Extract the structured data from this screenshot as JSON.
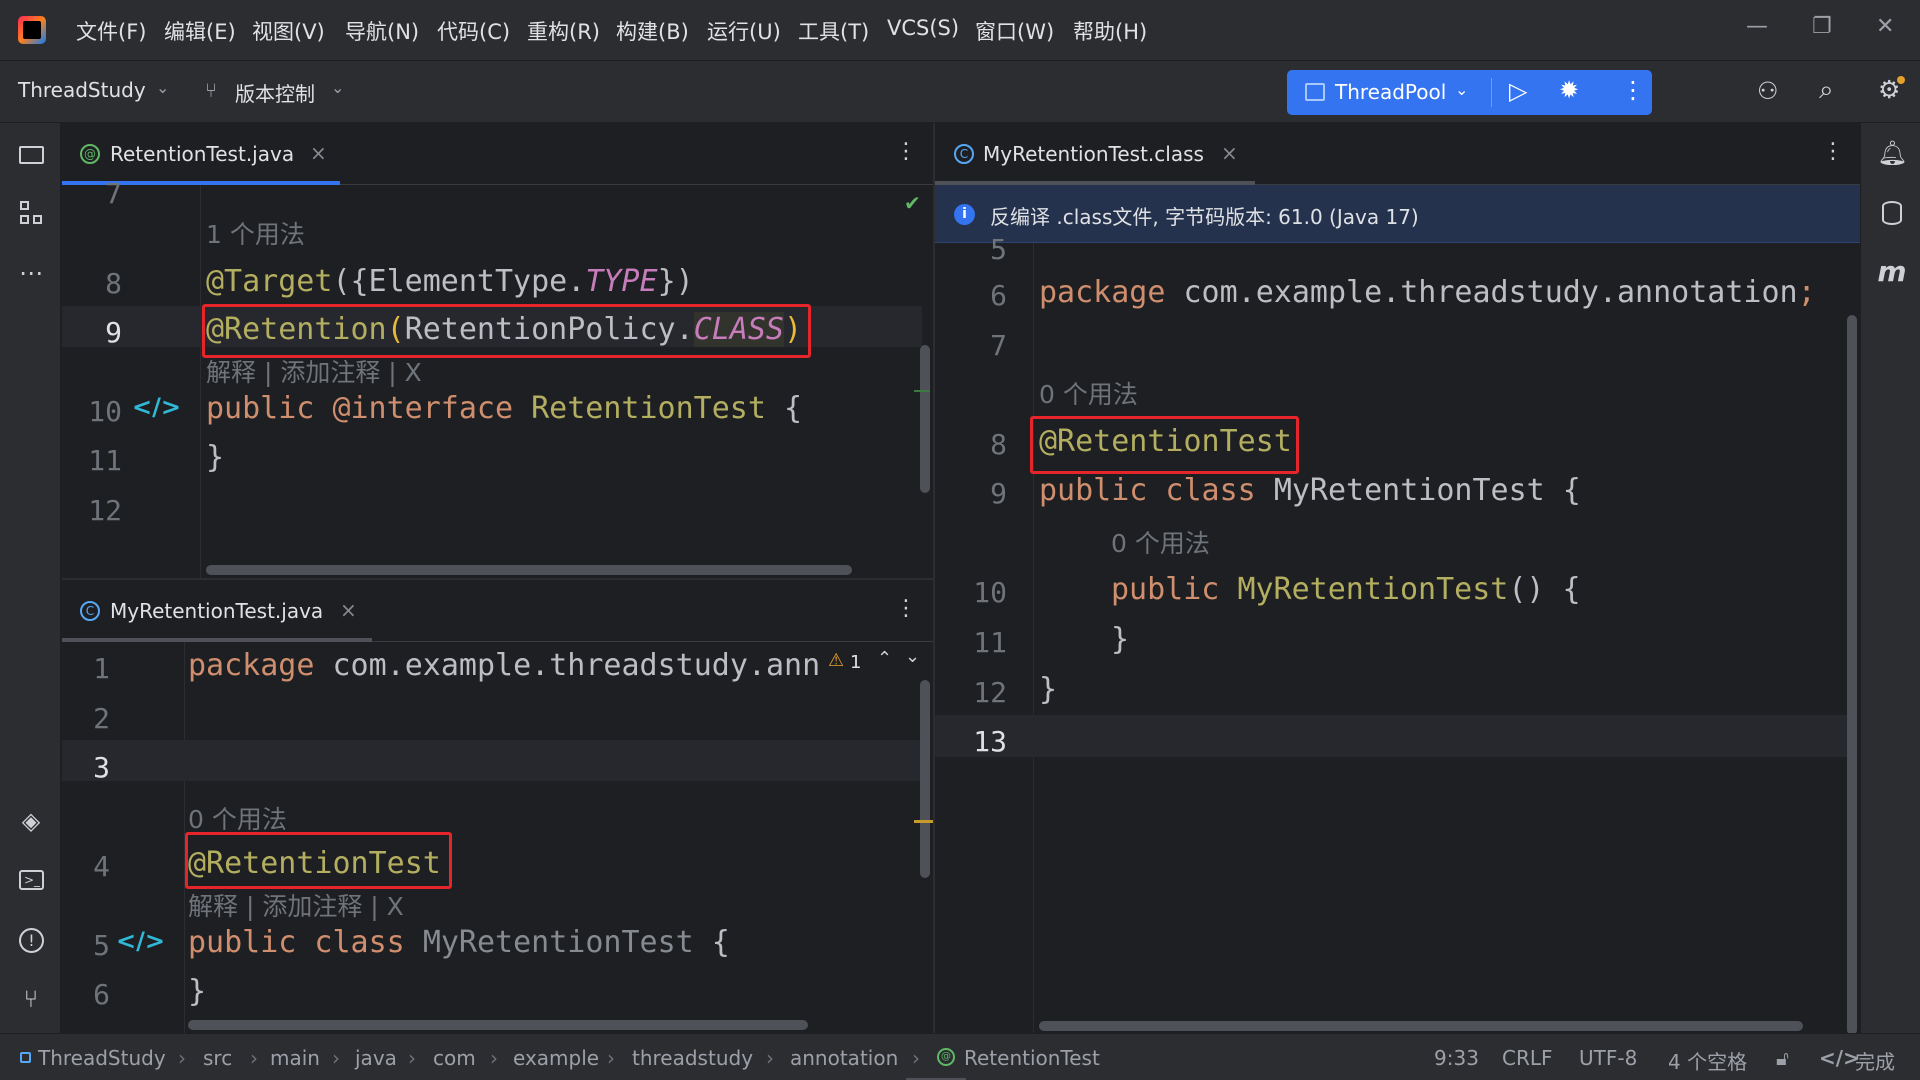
{
  "menu": [
    "文件(F)",
    "编辑(E)",
    "视图(V)",
    "导航(N)",
    "代码(C)",
    "重构(R)",
    "构建(B)",
    "运行(U)",
    "工具(T)",
    "VCS(S)",
    "窗口(W)",
    "帮助(H)"
  ],
  "toolbar": {
    "project": "ThreadStudy",
    "vcs": "版本控制",
    "run_config": "ThreadPool"
  },
  "editor_top_left": {
    "tab_label": "RetentionTest.java",
    "lines": [
      "8",
      "9",
      "10",
      "11",
      "12"
    ],
    "partial_line": "7",
    "usage_hint": "1 个用法",
    "inlay_hint": "解释 | 添加注释 | X",
    "code": {
      "l8_a": "@Target",
      "l8_b": "({ElementType.",
      "l8_c": "TYPE",
      "l8_d": "})",
      "l9_a": "@Retention",
      "l9_b": "(",
      "l9_c": "RetentionPolicy.",
      "l9_d": "CLASS",
      "l9_e": ")",
      "l10_a": "public ",
      "l10_b": "@interface ",
      "l10_c": "RetentionTest",
      "l10_d": " {",
      "l11": "}"
    }
  },
  "editor_bottom_left": {
    "tab_label": "MyRetentionTest.java",
    "lines": [
      "1",
      "2",
      "3",
      "4",
      "5",
      "6"
    ],
    "warning_count": "1",
    "usage_hint": "0 个用法",
    "inlay_hint": "解释 | 添加注释 | X",
    "code": {
      "l1_a": "package ",
      "l1_b": "com.example.threadstudy.ann",
      "l4": "@RetentionTest",
      "l5_a": "public class ",
      "l5_b": "MyRetentionTest",
      "l5_c": " {",
      "l6": "}"
    }
  },
  "editor_right": {
    "tab_label": "MyRetentionTest.class",
    "banner": "反编译 .class文件, 字节码版本: 61.0 (Java 17)",
    "partial_line": "5",
    "lines": [
      "6",
      "7",
      "8",
      "9",
      "10",
      "11",
      "12",
      "13"
    ],
    "usage_hint_class": "0 个用法",
    "usage_hint_ctor": "0 个用法",
    "code": {
      "l6_a": "package ",
      "l6_b": "com.example.threadstudy.annotation",
      "l6_c": ";",
      "l8": "@RetentionTest",
      "l9_a": "public class ",
      "l9_b": "MyRetentionTest",
      "l9_c": " {",
      "l10_a": "public ",
      "l10_b": "MyRetentionTest",
      "l10_c": "() {",
      "l11": "}",
      "l12": "}"
    }
  },
  "statusbar": {
    "breadcrumb": [
      "ThreadStudy",
      "src",
      "main",
      "java",
      "com",
      "example",
      "threadstudy",
      "annotation",
      "RetentionTest"
    ],
    "position": "9:33",
    "line_sep": "CRLF",
    "encoding": "UTF-8",
    "indent": "4 个空格",
    "status": "完成"
  },
  "colors": {
    "accent": "#3574f0",
    "highlight_box": "#e5252a",
    "keyword": "#cf8e6d",
    "annotation": "#b3ae60"
  }
}
